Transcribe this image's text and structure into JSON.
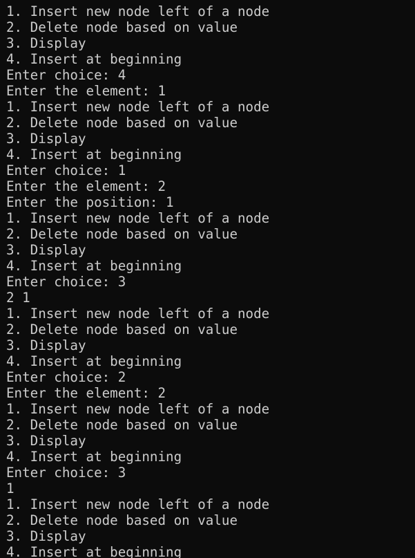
{
  "terminal": {
    "lines": [
      "1. Insert new node left of a node",
      "2. Delete node based on value",
      "3. Display",
      "4. Insert at beginning",
      "Enter choice: 4",
      "Enter the element: 1",
      "1. Insert new node left of a node",
      "2. Delete node based on value",
      "3. Display",
      "4. Insert at beginning",
      "Enter choice: 1",
      "Enter the element: 2",
      "Enter the position: 1",
      "1. Insert new node left of a node",
      "2. Delete node based on value",
      "3. Display",
      "4. Insert at beginning",
      "Enter choice: 3",
      "2 1",
      "1. Insert new node left of a node",
      "2. Delete node based on value",
      "3. Display",
      "4. Insert at beginning",
      "Enter choice: 2",
      "Enter the element: 2",
      "1. Insert new node left of a node",
      "2. Delete node based on value",
      "3. Display",
      "4. Insert at beginning",
      "Enter choice: 3",
      "1",
      "1. Insert new node left of a node",
      "2. Delete node based on value",
      "3. Display",
      "4. Insert at beginning"
    ]
  },
  "colors": {
    "background": "#0c0c0c",
    "foreground": "#cccccc"
  }
}
